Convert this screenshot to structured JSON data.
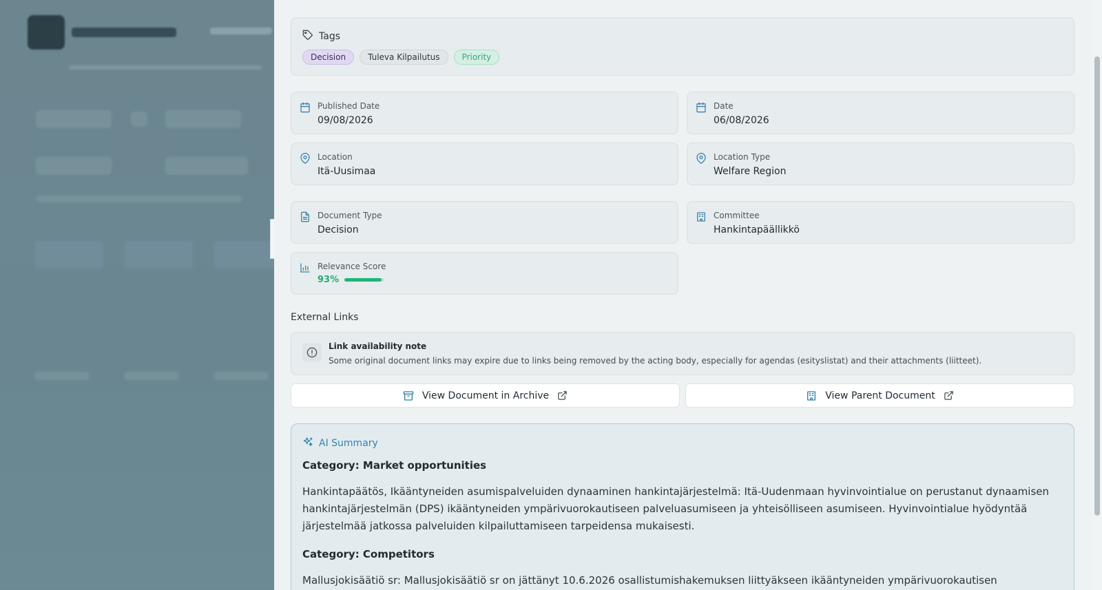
{
  "tags": {
    "heading": "Tags",
    "items": [
      "Decision",
      "Tuleva Kilpailutus",
      "Priority"
    ]
  },
  "fields": {
    "published_date": {
      "label": "Published Date",
      "value": "09/08/2026"
    },
    "date": {
      "label": "Date",
      "value": "06/08/2026"
    },
    "location": {
      "label": "Location",
      "value": "Itä-Uusimaa"
    },
    "location_type": {
      "label": "Location Type",
      "value": "Welfare Region"
    },
    "document_type": {
      "label": "Document Type",
      "value": "Decision"
    },
    "committee": {
      "label": "Committee",
      "value": "Hankintapäällikkö"
    },
    "relevance": {
      "label": "Relevance Score",
      "value": "93%",
      "fraction": 0.93
    }
  },
  "external_links": {
    "heading": "External Links",
    "note_title": "Link availability note",
    "note_text": "Some original document links may expire due to links being removed by the acting body, especially for agendas (esityslistat) and their attachments (liitteet).",
    "archive_button": "View Document in Archive",
    "parent_button": "View Parent Document"
  },
  "ai_summary": {
    "heading": "AI Summary",
    "category1": "Category: Market opportunities",
    "paragraph1": "Hankintapäätös, Ikääntyneiden asumispalveluiden dynaaminen hankintajärjestelmä: Itä-Uudenmaan hyvinvointialue on perustanut dynaamisen hankintajärjestelmän (DPS) ikääntyneiden ympärivuorokautiseen palveluasumiseen ja yhteisölliseen asumiseen. Hyvinvointialue hyödyntää järjestelmää jatkossa palveluiden kilpailuttamiseen tarpeidensa mukaisesti.",
    "category2": "Category: Competitors",
    "paragraph2": "Mallusjokisäätiö sr: Mallusjokisäätiö sr on jättänyt 10.6.2026 osallistumishakemuksen liittyäkseen ikääntyneiden ympärivuorokautisen"
  },
  "colors": {
    "accent": "#3285b0",
    "success": "#1fb57a",
    "tag_decision": "#e0d9f2",
    "tag_priority": "#d3f0e3"
  }
}
